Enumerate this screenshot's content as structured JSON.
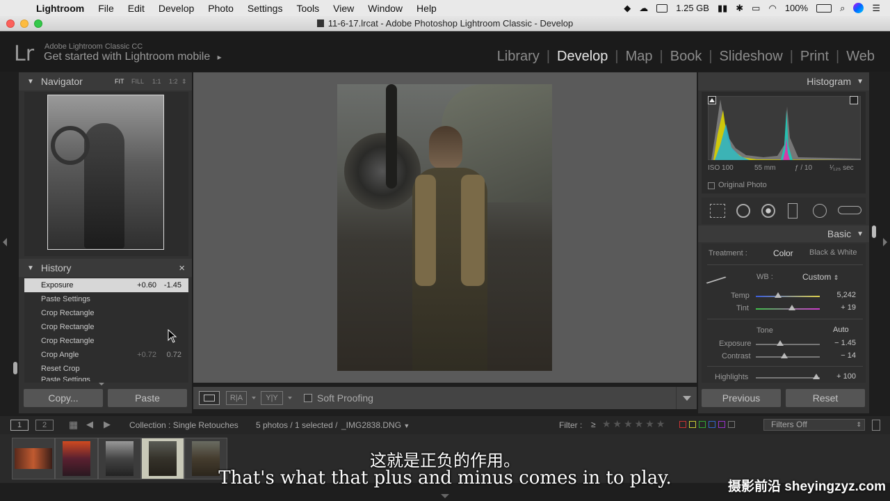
{
  "menubar": {
    "app_name": "Lightroom",
    "items": [
      "File",
      "Edit",
      "Develop",
      "Photo",
      "Settings",
      "Tools",
      "View",
      "Window",
      "Help"
    ],
    "memory": "1.25 GB",
    "battery": "100%"
  },
  "window": {
    "title": "11-6-17.lrcat - Adobe Photoshop Lightroom Classic - Develop"
  },
  "identity": {
    "logo": "Lr",
    "line1": "Adobe Lightroom Classic CC",
    "line2": "Get started with Lightroom mobile",
    "arrow": "▸"
  },
  "modules": [
    "Library",
    "Develop",
    "Map",
    "Book",
    "Slideshow",
    "Print",
    "Web"
  ],
  "navigator": {
    "title": "Navigator",
    "zoom_options": [
      "FIT",
      "FILL",
      "1:1",
      "1:2"
    ]
  },
  "history": {
    "title": "History",
    "close": "×",
    "rows": [
      {
        "label": "Exposure",
        "v1": "+0.60",
        "v2": "-1.45"
      },
      {
        "label": "Paste Settings",
        "v1": "",
        "v2": ""
      },
      {
        "label": "Crop Rectangle",
        "v1": "",
        "v2": ""
      },
      {
        "label": "Crop Rectangle",
        "v1": "",
        "v2": ""
      },
      {
        "label": "Crop Rectangle",
        "v1": "",
        "v2": ""
      },
      {
        "label": "Crop Angle",
        "v1": "+0.72",
        "v2": "0.72"
      },
      {
        "label": "Reset Crop",
        "v1": "",
        "v2": ""
      },
      {
        "label": "Paste Settings",
        "v1": "",
        "v2": ""
      }
    ]
  },
  "left_buttons": {
    "copy": "Copy...",
    "paste": "Paste"
  },
  "toolbar": {
    "soft_proofing": "Soft Proofing"
  },
  "histogram": {
    "title": "Histogram",
    "iso": "ISO 100",
    "focal": "55 mm",
    "aperture": "ƒ / 10",
    "shutter": "¹⁄₁₂₅ sec",
    "original_photo": "Original Photo"
  },
  "basic": {
    "title": "Basic",
    "treatment_label": "Treatment :",
    "color": "Color",
    "bw": "Black & White",
    "wb_label": "WB :",
    "wb_value": "Custom",
    "temp_label": "Temp",
    "temp_value": "5,242",
    "tint_label": "Tint",
    "tint_value": "+ 19",
    "tone_label": "Tone",
    "auto": "Auto",
    "exposure_label": "Exposure",
    "exposure_value": "− 1.45",
    "contrast_label": "Contrast",
    "contrast_value": "− 14",
    "highlights_label": "Highlights",
    "highlights_value": "+ 100"
  },
  "right_buttons": {
    "previous": "Previous",
    "reset": "Reset"
  },
  "filmstrip_bar": {
    "view1": "1",
    "view2": "2",
    "collection": "Collection : Single Retouches",
    "count": "5 photos / 1 selected /",
    "filename": "_IMG2838.DNG",
    "filter_label": "Filter :",
    "filter_op": "≥",
    "filters_off": "Filters Off"
  },
  "subtitles": {
    "zh": "这就是正负的作用。",
    "en": "That's what that plus and minus comes in to play.",
    "watermark": "摄影前沿 sheyingzyz.com"
  },
  "colors": {
    "accent": "#e8e8e8",
    "panel": "#323232",
    "background": "#1e1e1e"
  }
}
